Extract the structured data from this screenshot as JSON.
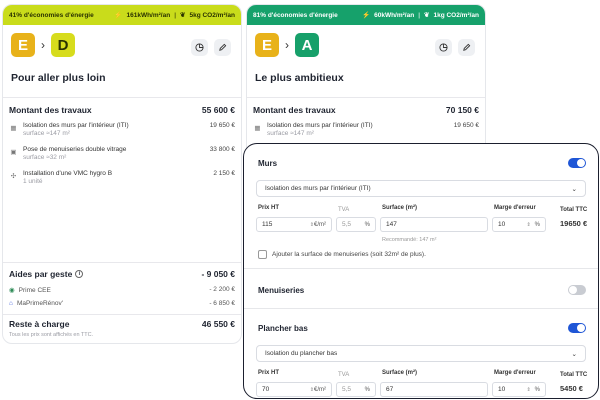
{
  "card1": {
    "banner_left": "41% d'économies d'énergie",
    "energy": "161kWh/m²/an",
    "co2": "5kg CO2/m²/an",
    "from_label": "E",
    "to_label": "D",
    "from_color": "#e8b21a",
    "to_color": "#d7dc1d",
    "title": "Pour aller plus loin",
    "works_label": "Montant des travaux",
    "works_total": "55 600 €",
    "items": [
      {
        "name": "Isolation des murs par l'intérieur (ITI)",
        "sub": "surface ≈147 m²",
        "price": "19 650 €"
      },
      {
        "name": "Pose de menuiseries double vitrage",
        "sub": "surface ≈32 m²",
        "price": "33 800 €"
      },
      {
        "name": "Installation d'une VMC hygro B",
        "sub": "1 unité",
        "price": "2 150 €"
      }
    ],
    "aids_label": "Aides par geste",
    "aids_total": "- 9 050 €",
    "aids": [
      {
        "name": "Prime CEE",
        "value": "- 2 200 €"
      },
      {
        "name": "MaPrimeRénov'",
        "value": "- 6 850 €"
      }
    ],
    "rest_label": "Reste à charge",
    "rest_total": "46 550 €",
    "note": "Tous les prix sont affichés en TTC."
  },
  "card2": {
    "banner_left": "81% d'économies d'énergie",
    "energy": "60kWh/m²/an",
    "co2": "1kg CO2/m²/an",
    "from_label": "E",
    "to_label": "A",
    "from_color": "#e8b21a",
    "to_color": "#17a06a",
    "title": "Le plus ambitieux",
    "works_label": "Montant des travaux",
    "works_total": "70 150 €",
    "items": [
      {
        "name": "Isolation des murs par l'intérieur (ITI)",
        "sub": "surface ≈147 m²",
        "price": "19 650 €"
      }
    ]
  },
  "panel": {
    "murs": {
      "title": "Murs",
      "enabled": true,
      "select": "Isolation des murs par l'intérieur (ITI)",
      "prix_label": "Prix HT",
      "prix": "115",
      "prix_unit": "€/m²",
      "tva_label": "TVA",
      "tva": "5,5",
      "tva_unit": "%",
      "surface_label": "Surface (m²)",
      "surface": "147",
      "marge_label": "Marge d'erreur",
      "marge": "10",
      "marge_unit": "%",
      "total_label": "Total TTC",
      "total": "19650 €",
      "reco": "Recommandé: 147 m²",
      "checkbox_label": "Ajouter la surface de menuiseries (soit 32m² de plus)."
    },
    "menuiseries": {
      "title": "Menuiseries",
      "enabled": false
    },
    "plancher": {
      "title": "Plancher bas",
      "enabled": true,
      "select": "Isolation du plancher bas",
      "prix_label": "Prix HT",
      "prix": "70",
      "prix_unit": "€/m²",
      "tva_label": "TVA",
      "tva": "5,5",
      "tva_unit": "%",
      "surface_label": "Surface (m²)",
      "surface": "67",
      "marge_label": "Marge d'erreur",
      "marge": "10",
      "marge_unit": "%",
      "total_label": "Total TTC",
      "total": "5450 €"
    }
  }
}
